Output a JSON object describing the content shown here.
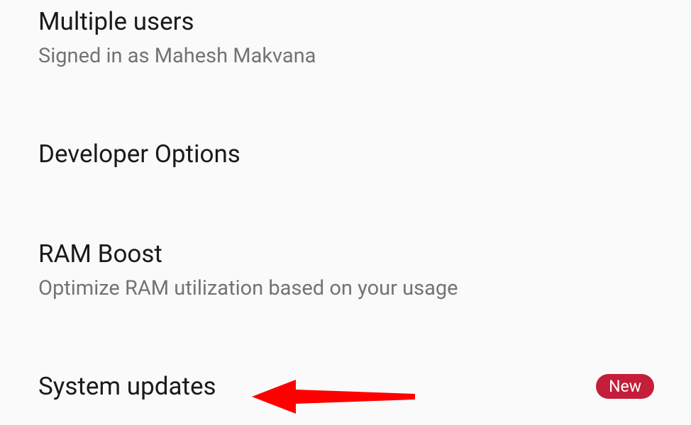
{
  "settings": {
    "multipleUsers": {
      "title": "Multiple users",
      "subtitle": "Signed in as Mahesh Makvana"
    },
    "developerOptions": {
      "title": "Developer Options"
    },
    "ramBoost": {
      "title": "RAM Boost",
      "subtitle": "Optimize RAM utilization based on your usage"
    },
    "systemUpdates": {
      "title": "System updates",
      "badge": "New"
    }
  },
  "annotation": {
    "arrowColor": "#ff0000"
  }
}
